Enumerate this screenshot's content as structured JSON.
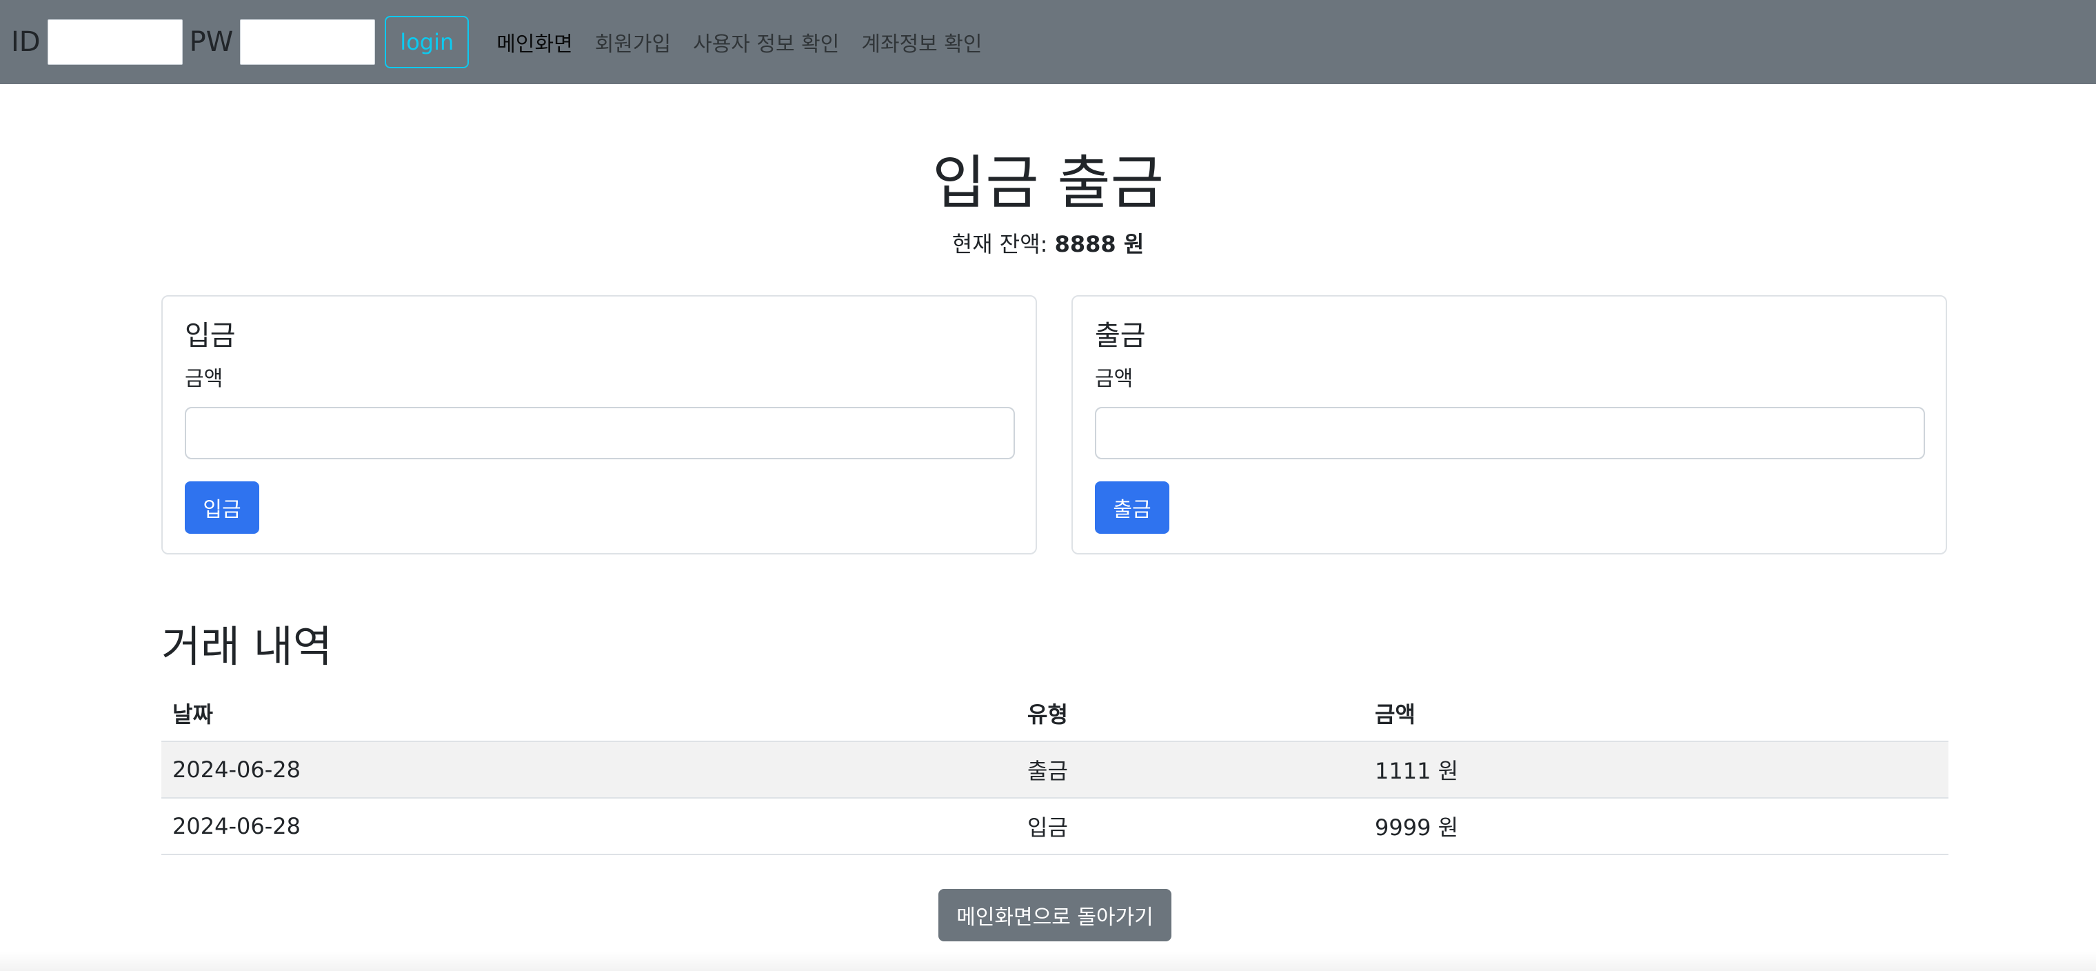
{
  "navbar": {
    "id_label": "ID",
    "id_value": "",
    "pw_label": "PW",
    "pw_value": "",
    "login_label": "login",
    "links": [
      {
        "label": "메인화면",
        "active": true
      },
      {
        "label": "회원가입",
        "active": false
      },
      {
        "label": "사용자 정보 확인",
        "active": false
      },
      {
        "label": "계좌정보 확인",
        "active": false
      }
    ],
    "background": "#6c757d",
    "login_color": "#0dcaf0"
  },
  "header": {
    "title": "입금 출금",
    "balance_label": "현재 잔액:",
    "balance_value": "8888 원"
  },
  "deposit": {
    "title": "입금",
    "amount_label": "금액",
    "amount_value": "",
    "button_label": "입금"
  },
  "withdraw": {
    "title": "출금",
    "amount_label": "금액",
    "amount_value": "",
    "button_label": "출금"
  },
  "history": {
    "title": "거래 내역",
    "columns": [
      "날짜",
      "유형",
      "금액"
    ],
    "rows": [
      {
        "date": "2024-06-28",
        "type": "출금",
        "amount": "1111 원"
      },
      {
        "date": "2024-06-28",
        "type": "입금",
        "amount": "9999 원"
      }
    ]
  },
  "back_button_label": "메인화면으로 돌아가기",
  "colors": {
    "primary": "#2f73ef",
    "secondary": "#6c757d"
  }
}
